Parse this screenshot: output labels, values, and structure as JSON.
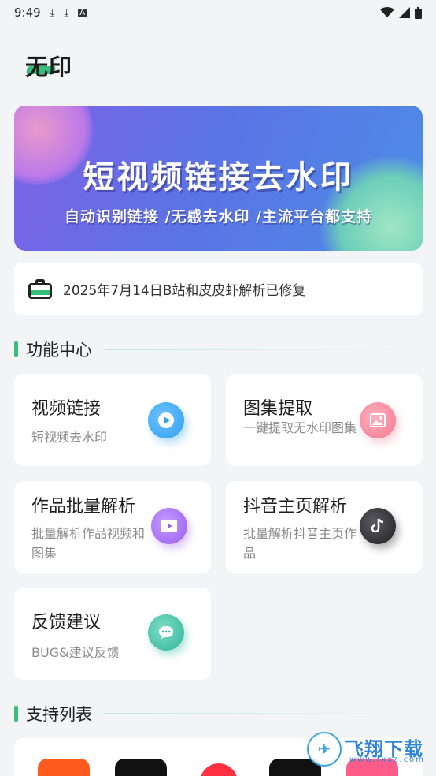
{
  "status_bar": {
    "time": "9:49"
  },
  "app": {
    "logo_text": "无印"
  },
  "banner": {
    "title": "短视频链接去水印",
    "subtitle": "自动识别链接 /无感去水印 /主流平台都支持"
  },
  "notice": {
    "text": "2025年7月14日B站和皮皮虾解析已修复"
  },
  "sections": {
    "features": "功能中心",
    "support": "支持列表"
  },
  "cards": [
    {
      "title": "视频链接",
      "subtitle": "短视频去水印",
      "icon": "play-icon",
      "color": "#2f9ff0"
    },
    {
      "title": "图集提取",
      "subtitle": "一键提取无水印图集",
      "icon": "image-icon",
      "color": "#f2788f"
    },
    {
      "title": "作品批量解析",
      "subtitle": "批量解析作品视频和图集",
      "icon": "video-icon",
      "color": "#9b5cf0"
    },
    {
      "title": "抖音主页解析",
      "subtitle": "批量解析抖音主页作品",
      "icon": "tiktok-icon",
      "color": "#2a2a2e"
    },
    {
      "title": "反馈建议",
      "subtitle": "BUG&建议反馈",
      "icon": "chat-icon",
      "color": "#2fb59a"
    }
  ],
  "support_apps": [
    {
      "icon": "kuaishou-icon",
      "color": "#ff5a1f"
    },
    {
      "icon": "douyin-icon",
      "color": "#111111"
    },
    {
      "icon": "weibo-icon",
      "color": "#ff3040"
    },
    {
      "icon": "capcut-icon",
      "color": "#111111"
    },
    {
      "icon": "pipixia-icon",
      "color": "#ff5c8a"
    }
  ],
  "watermark": {
    "title": "飞翔下载",
    "url": "www.fxxz.com"
  }
}
